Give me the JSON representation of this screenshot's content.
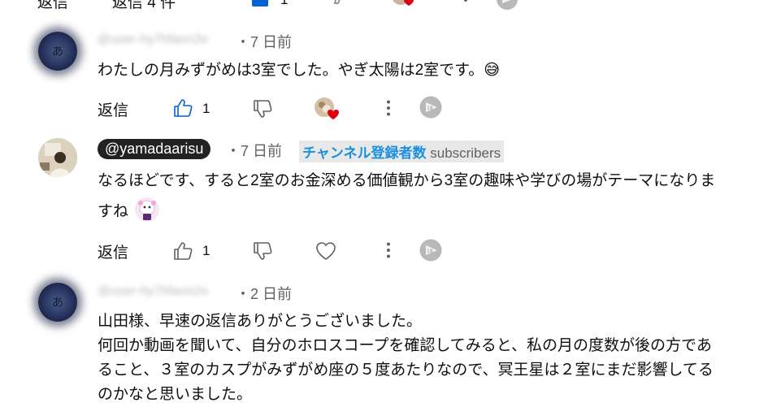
{
  "top_partial": {
    "reply_label": "返信",
    "replies_toggle": "返信 4 件",
    "like_count": "1"
  },
  "comments": [
    {
      "author": "@user-hy7hfaon2e",
      "time": "7 日前",
      "text": "わたしの月みずがめは3室でした。やぎ太陽は2室です。😅",
      "reply_label": "返信",
      "like_count": "1"
    },
    {
      "author": "@yamadaarisu",
      "time": "7 日前",
      "badge_label": "チャンネル登録者数",
      "badge_suffix": "subscribers",
      "text_line1": "なるほどです、すると2室のお金深める価値観から3室の趣味や学びの場がテーマになりま",
      "text_line2": "すね",
      "reply_label": "返信",
      "like_count": "1"
    },
    {
      "author": "@user-hy7hfaon2e",
      "time": "2 日前",
      "lines": [
        "山田様、早速の返信ありがとうございました。",
        "何回か動画を聞いて、自分のホロスコープを確認してみると、私の月の度数が後の方であ",
        "ること、３室のカスプがみずがめ座の５度あたりなので、冥王星は２室にまだ影響してる",
        "のかなと思いました。"
      ]
    }
  ],
  "separator": "・",
  "colors": {
    "like_active": "#065fd4",
    "heart": "#e00010",
    "badge_blue": "#1a8fdc"
  },
  "icons": [
    "like-icon",
    "dislike-icon",
    "creator-heart-icon",
    "more-icon",
    "translate-icon",
    "heart-outline-icon"
  ]
}
